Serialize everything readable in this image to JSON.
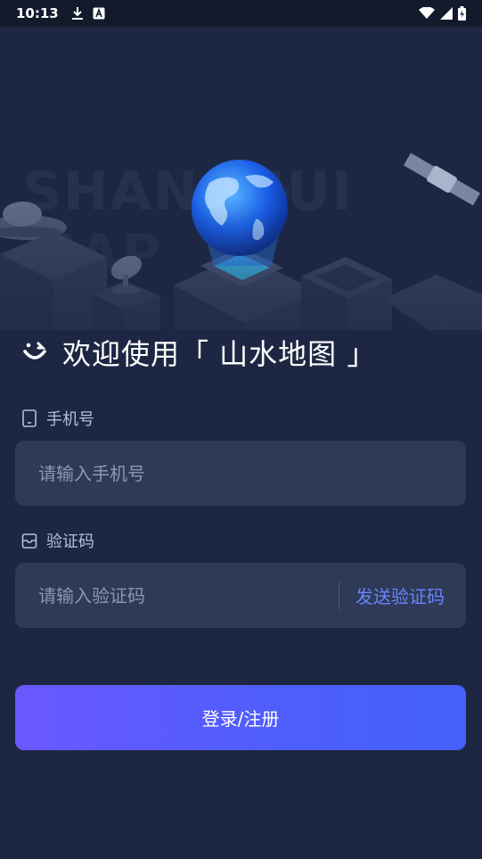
{
  "status_bar": {
    "time": "10:13",
    "left_icons": [
      "download-icon",
      "keyboard-icon"
    ],
    "right_icons": [
      "wifi-icon",
      "signal-icon",
      "battery-icon"
    ]
  },
  "hero": {
    "watermark": "SHANSHUI MAP"
  },
  "welcome": {
    "text": "欢迎使用「 山水地图 」"
  },
  "phone": {
    "label": "手机号",
    "placeholder": "请输入手机号",
    "value": ""
  },
  "code": {
    "label": "验证码",
    "placeholder": "请输入验证码",
    "value": "",
    "send_label": "发送验证码"
  },
  "submit": {
    "label": "登录/注册"
  },
  "colors": {
    "background": "#1d2743",
    "input_background": "#2e3a57",
    "accent": "#6a83ff",
    "button_gradient_start": "#6a58ff",
    "button_gradient_end": "#4560fb"
  }
}
